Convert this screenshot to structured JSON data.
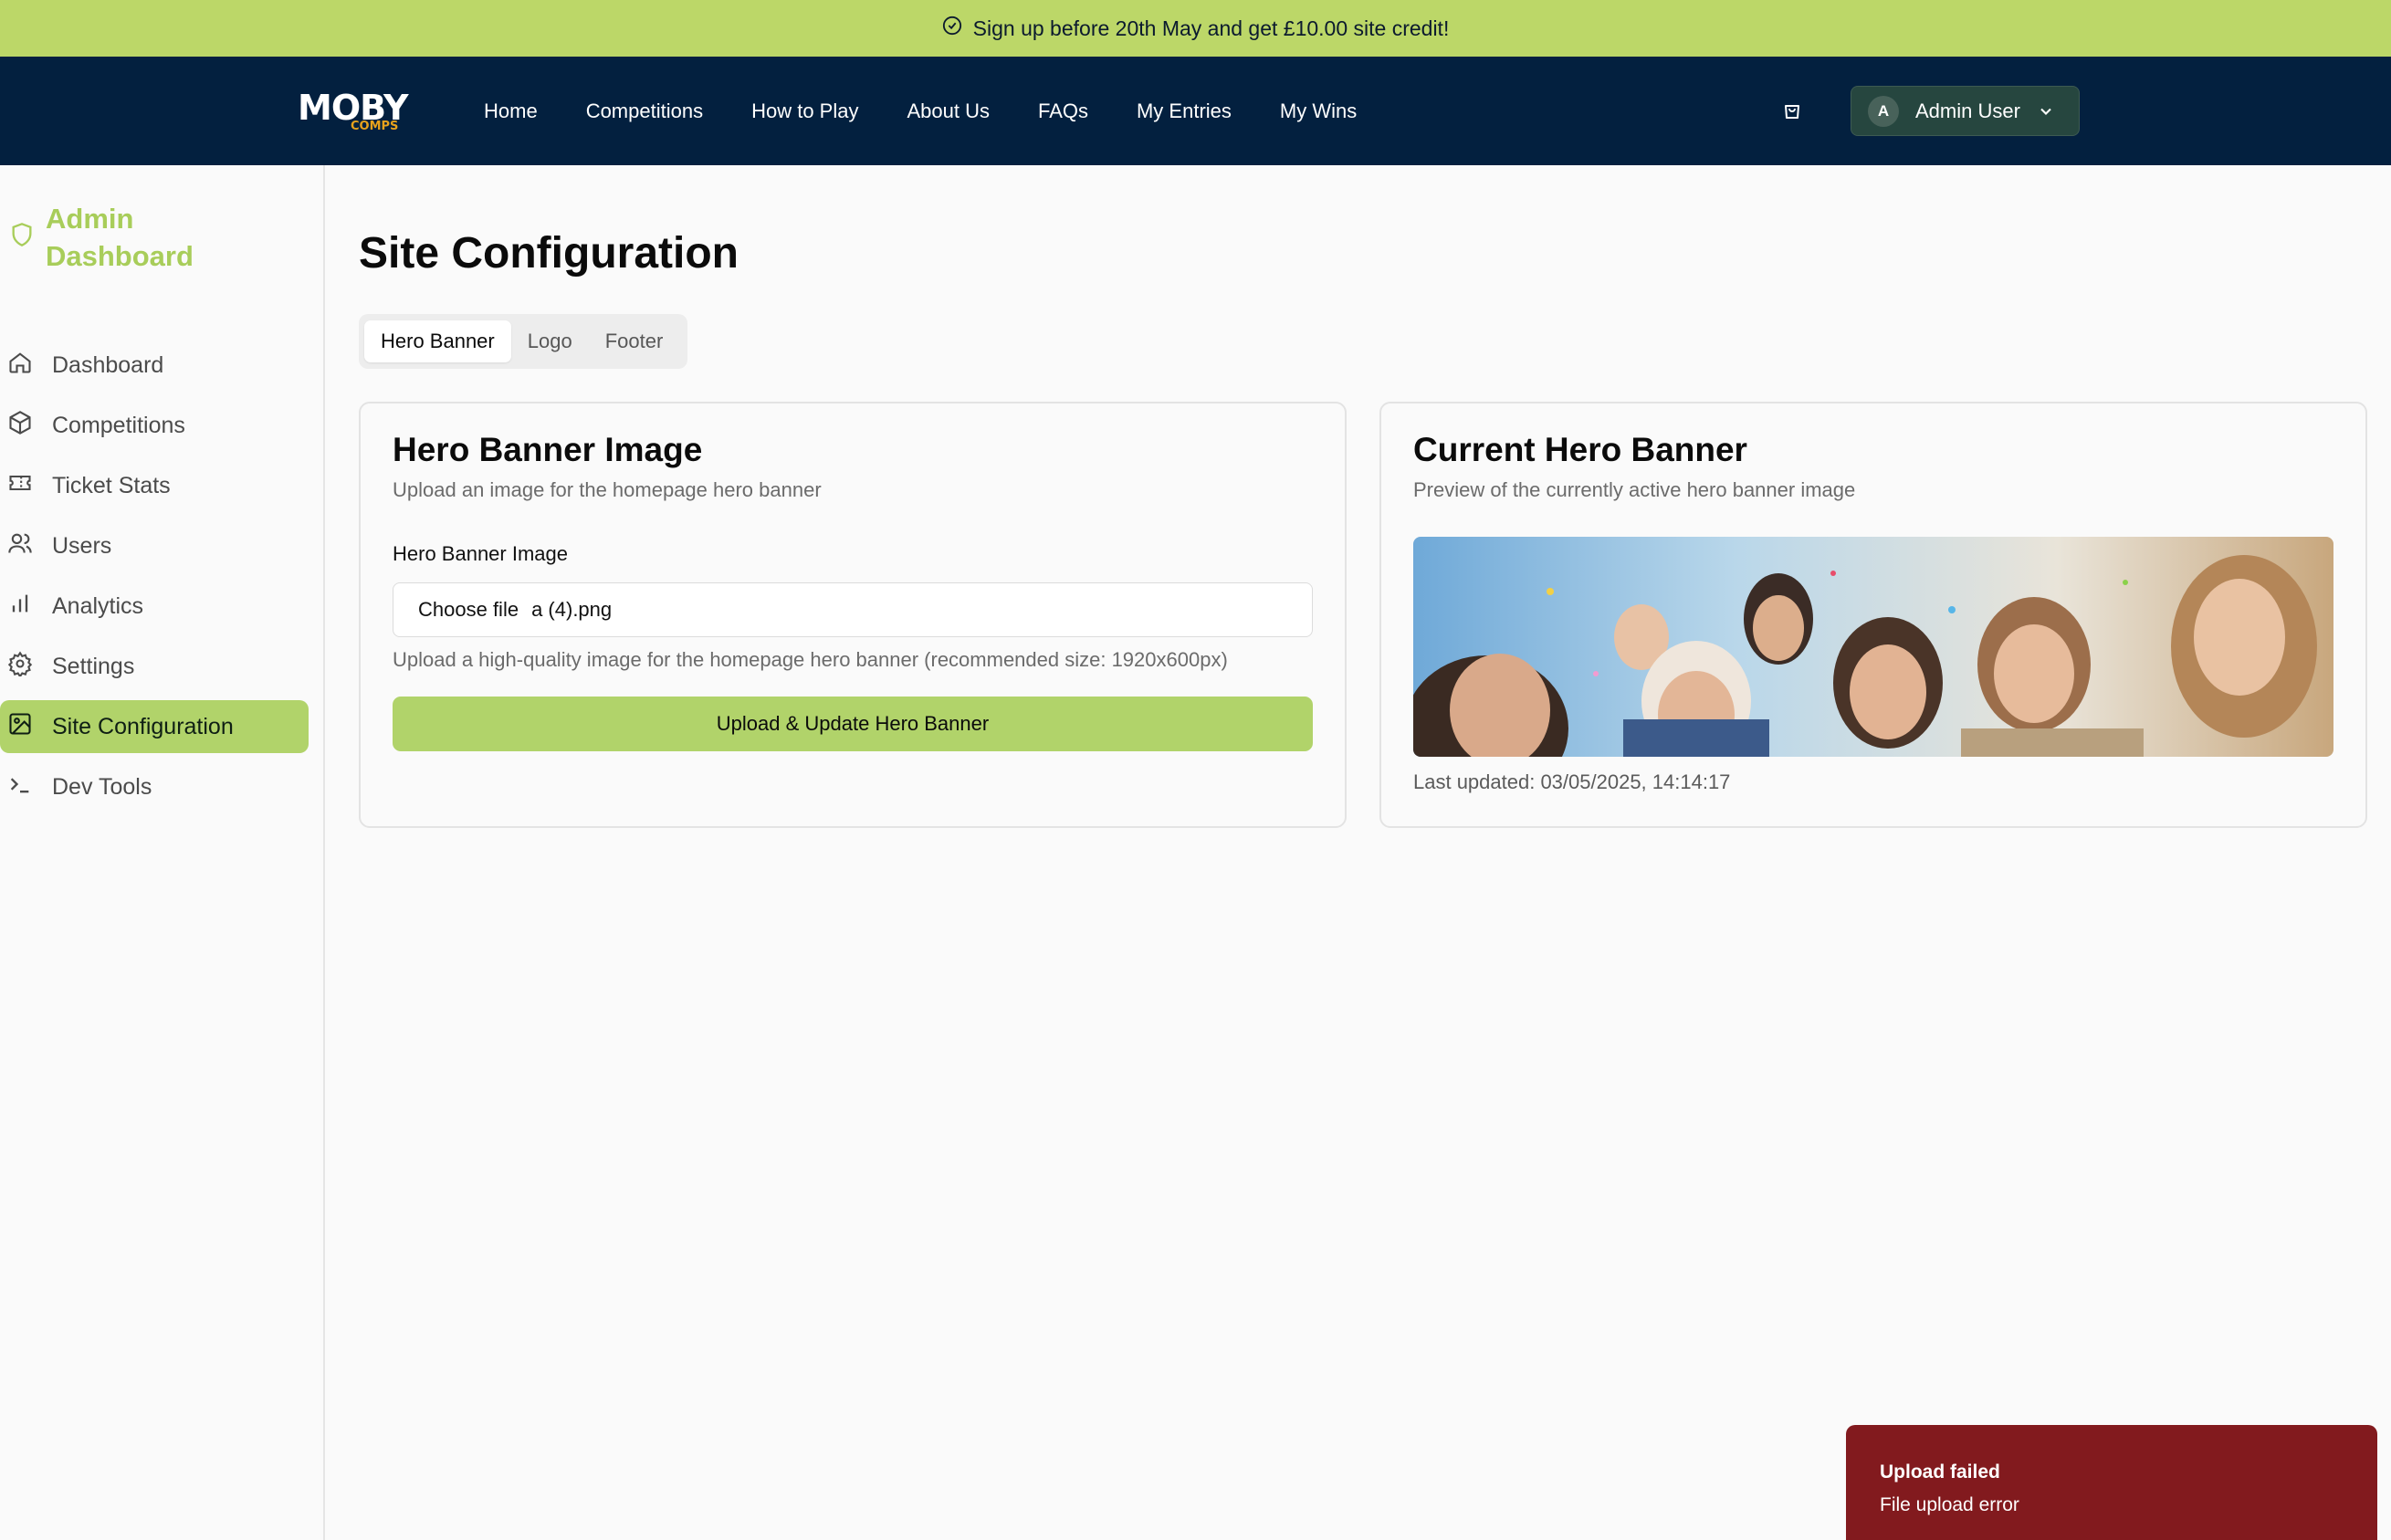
{
  "promo": {
    "text": "Sign up before 20th May and get £10.00 site credit!"
  },
  "nav": {
    "logo_main": "MOBY",
    "logo_sub": "COMPS",
    "items": [
      "Home",
      "Competitions",
      "How to Play",
      "About Us",
      "FAQs",
      "My Entries",
      "My Wins"
    ],
    "user": {
      "initial": "A",
      "name": "Admin User"
    }
  },
  "sidebar": {
    "title": "Admin Dashboard",
    "items": [
      {
        "label": "Dashboard",
        "icon": "home-icon"
      },
      {
        "label": "Competitions",
        "icon": "box-icon"
      },
      {
        "label": "Ticket Stats",
        "icon": "ticket-icon"
      },
      {
        "label": "Users",
        "icon": "users-icon"
      },
      {
        "label": "Analytics",
        "icon": "bar-chart-icon"
      },
      {
        "label": "Settings",
        "icon": "gear-icon"
      },
      {
        "label": "Site Configuration",
        "icon": "image-icon",
        "active": true
      },
      {
        "label": "Dev Tools",
        "icon": "terminal-icon"
      }
    ]
  },
  "main": {
    "title": "Site Configuration",
    "tabs": [
      {
        "label": "Hero Banner",
        "active": true
      },
      {
        "label": "Logo"
      },
      {
        "label": "Footer"
      }
    ],
    "upload_card": {
      "title": "Hero Banner Image",
      "subtitle": "Upload an image for the homepage hero banner",
      "field_label": "Hero Banner Image",
      "choose_label": "Choose file",
      "file_name": "a (4).png",
      "hint": "Upload a high-quality image for the homepage hero banner (recommended size: 1920x600px)",
      "button": "Upload & Update Hero Banner"
    },
    "preview_card": {
      "title": "Current Hero Banner",
      "subtitle": "Preview of the currently active hero banner image",
      "last_updated": "Last updated: 03/05/2025, 14:14:17"
    }
  },
  "toast": {
    "title": "Upload failed",
    "message": "File upload error"
  },
  "colors": {
    "promo": "#bcd768",
    "nav": "#03203f",
    "accent": "#b1d36a",
    "brand_text": "#a8cd5a",
    "toast": "#821a1e"
  }
}
